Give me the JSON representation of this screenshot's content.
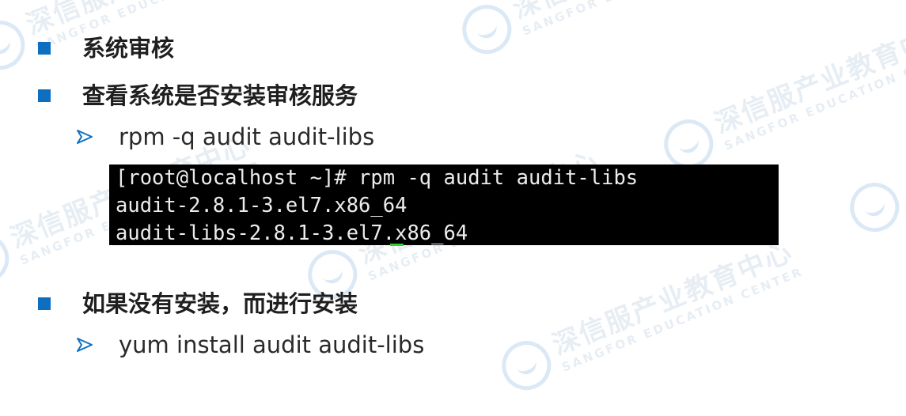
{
  "watermark": {
    "brand_cn": "深信服产业教育中心",
    "brand_en": "SANGFOR EDUCATION CENTER"
  },
  "colors": {
    "bullet_square": "#0e6fc1",
    "arrow": "#0e6fc1",
    "terminal_bg": "#000000",
    "terminal_text": "#ececec",
    "cursor": "#2fd12f"
  },
  "content": {
    "item1": {
      "heading": "系统审核"
    },
    "item2": {
      "heading": "查看系统是否安装审核服务",
      "sub": "rpm -q audit audit-libs"
    },
    "terminal": {
      "lines": [
        "[root@localhost ~]# rpm -q audit audit-libs",
        "audit-2.8.1-3.el7.x86_64",
        "audit-libs-2.8.1-3.el7.x86_64"
      ]
    },
    "item3": {
      "heading": "如果没有安装，而进行安装",
      "sub": "yum install audit audit-libs"
    }
  }
}
